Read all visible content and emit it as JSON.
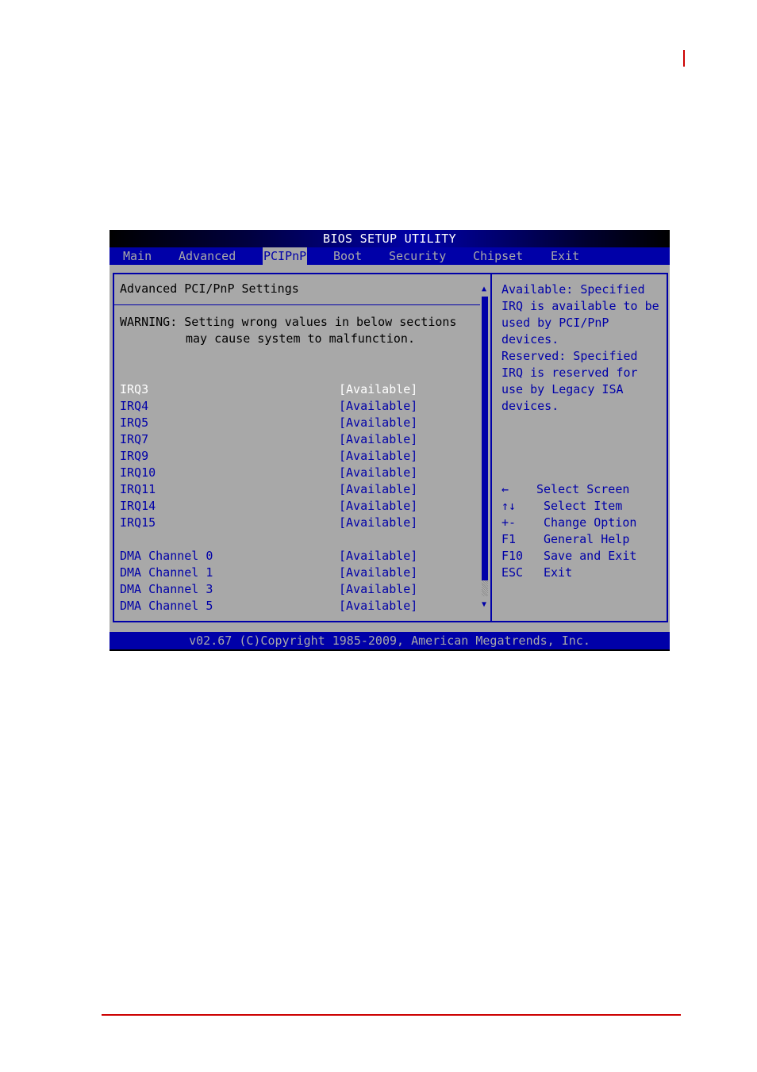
{
  "colors": {
    "accent": "#cc0000",
    "bios_blue": "#0000a8",
    "bios_gray": "#a8a8a8",
    "selected_text": "#ffffff"
  },
  "bios": {
    "title": "BIOS SETUP UTILITY",
    "menu": [
      {
        "label": "Main",
        "active": false
      },
      {
        "label": "Advanced",
        "active": false
      },
      {
        "label": "PCIPnP",
        "active": true
      },
      {
        "label": "Boot",
        "active": false
      },
      {
        "label": "Security",
        "active": false
      },
      {
        "label": "Chipset",
        "active": false
      },
      {
        "label": "Exit",
        "active": false
      }
    ],
    "section_title": "Advanced PCI/PnP Settings",
    "warning": {
      "line1": "WARNING: Setting wrong values in below sections",
      "line2": "may cause system to malfunction."
    },
    "irq_items": [
      {
        "label": "IRQ3",
        "value": "[Available]",
        "selected": true
      },
      {
        "label": "IRQ4",
        "value": "[Available]"
      },
      {
        "label": "IRQ5",
        "value": "[Available]"
      },
      {
        "label": "IRQ7",
        "value": "[Available]"
      },
      {
        "label": "IRQ9",
        "value": "[Available]"
      },
      {
        "label": "IRQ10",
        "value": "[Available]"
      },
      {
        "label": "IRQ11",
        "value": "[Available]"
      },
      {
        "label": "IRQ14",
        "value": "[Available]"
      },
      {
        "label": "IRQ15",
        "value": "[Available]"
      }
    ],
    "dma_items": [
      {
        "label": "DMA Channel 0",
        "value": "[Available]"
      },
      {
        "label": "DMA Channel 1",
        "value": "[Available]"
      },
      {
        "label": "DMA Channel 3",
        "value": "[Available]"
      },
      {
        "label": "DMA Channel 5",
        "value": "[Available]"
      }
    ],
    "scrollbar": {
      "up_icon": "▲",
      "down_icon": "▼"
    },
    "help_text": [
      "Available: Specified",
      "IRQ is available to be",
      "used by PCI/PnP",
      "devices.",
      "Reserved: Specified",
      "IRQ is reserved for",
      "use by Legacy ISA",
      "devices."
    ],
    "key_help": [
      {
        "key": "←",
        "desc": "Select Screen"
      },
      {
        "key": "↑↓",
        "desc": "Select Item"
      },
      {
        "key": "+-",
        "desc": "Change Option"
      },
      {
        "key": "F1",
        "desc": "General Help"
      },
      {
        "key": "F10",
        "desc": "Save and Exit"
      },
      {
        "key": "ESC",
        "desc": "Exit"
      }
    ],
    "footer": "v02.67 (C)Copyright 1985-2009, American Megatrends, Inc."
  }
}
